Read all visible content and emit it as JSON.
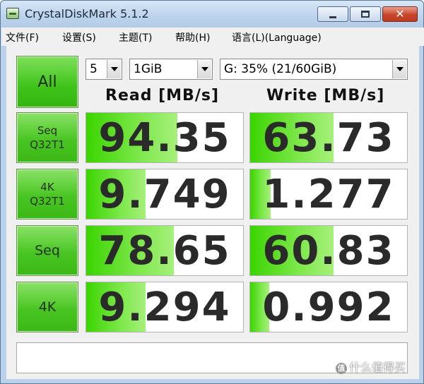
{
  "window": {
    "title": "CrystalDiskMark 5.1.2"
  },
  "menu": {
    "items": [
      "文件(F)",
      "设置(S)",
      "主题(T)",
      "帮助(H)",
      "语言(L)(Language)"
    ]
  },
  "controls": {
    "all_label": "All",
    "test_count": "5",
    "test_size": "1GiB",
    "drive": "G: 35% (21/60GiB)"
  },
  "headers": {
    "read": "Read [MB/s]",
    "write": "Write [MB/s]"
  },
  "rows": [
    {
      "label_line1": "Seq",
      "label_line2": "Q32T1",
      "read": "94.35",
      "write": "63.73",
      "read_fill": 0.58,
      "write_fill": 0.53
    },
    {
      "label_line1": "4K",
      "label_line2": "Q32T1",
      "read": "9.749",
      "write": "1.277",
      "read_fill": 0.38,
      "write_fill": 0.13
    },
    {
      "label_line1": "Seq",
      "label_line2": "",
      "read": "78.65",
      "write": "60.83",
      "read_fill": 0.56,
      "write_fill": 0.53
    },
    {
      "label_line1": "4K",
      "label_line2": "",
      "read": "9.294",
      "write": "0.992",
      "read_fill": 0.38,
      "write_fill": 0.12
    }
  ],
  "comment": "",
  "watermark": "什么值得买",
  "colors": {
    "button_green": "#48c522",
    "bar_green": "#3bd400"
  }
}
